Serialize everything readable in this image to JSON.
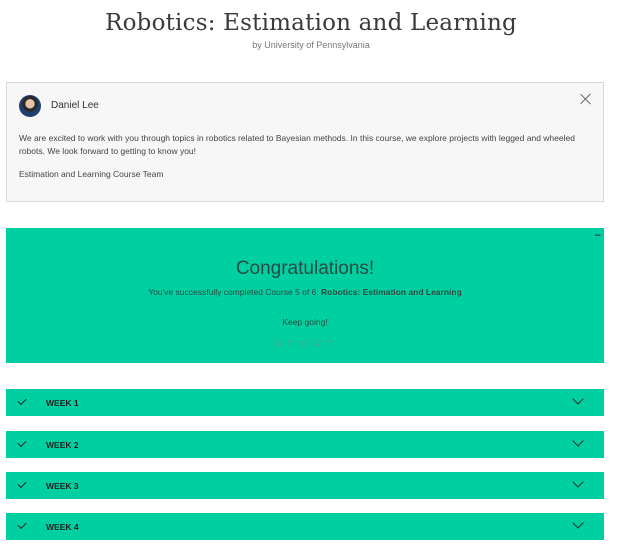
{
  "course": {
    "title": "Robotics: Estimation and Learning",
    "provider": "by University of Pennsylvania"
  },
  "instructor_message": {
    "name": "Daniel Lee",
    "message": "We are excited to work with you through topics in robotics related to Bayesian methods. In this course, we explore projects with legged and wheeled robots. We look forward to getting to know you!",
    "signature": "Estimation and Learning Course Team",
    "close_icon": "close-icon"
  },
  "completion": {
    "heading": "Congratulations!",
    "line_prefix": "You've successfully completed Course 5 of 6: ",
    "line_course": "Robotics: Estimation and Learning",
    "keep_going": "Keep going!",
    "menu": "...",
    "rating": {
      "value": 0,
      "max": 5,
      "star": "☆"
    }
  },
  "weeks": [
    {
      "label": "WEEK 1"
    },
    {
      "label": "WEEK 2"
    },
    {
      "label": "WEEK 3"
    },
    {
      "label": "WEEK 4"
    }
  ],
  "colors": {
    "accent": "#00d0a1",
    "card_bg": "#f7f7f7"
  }
}
